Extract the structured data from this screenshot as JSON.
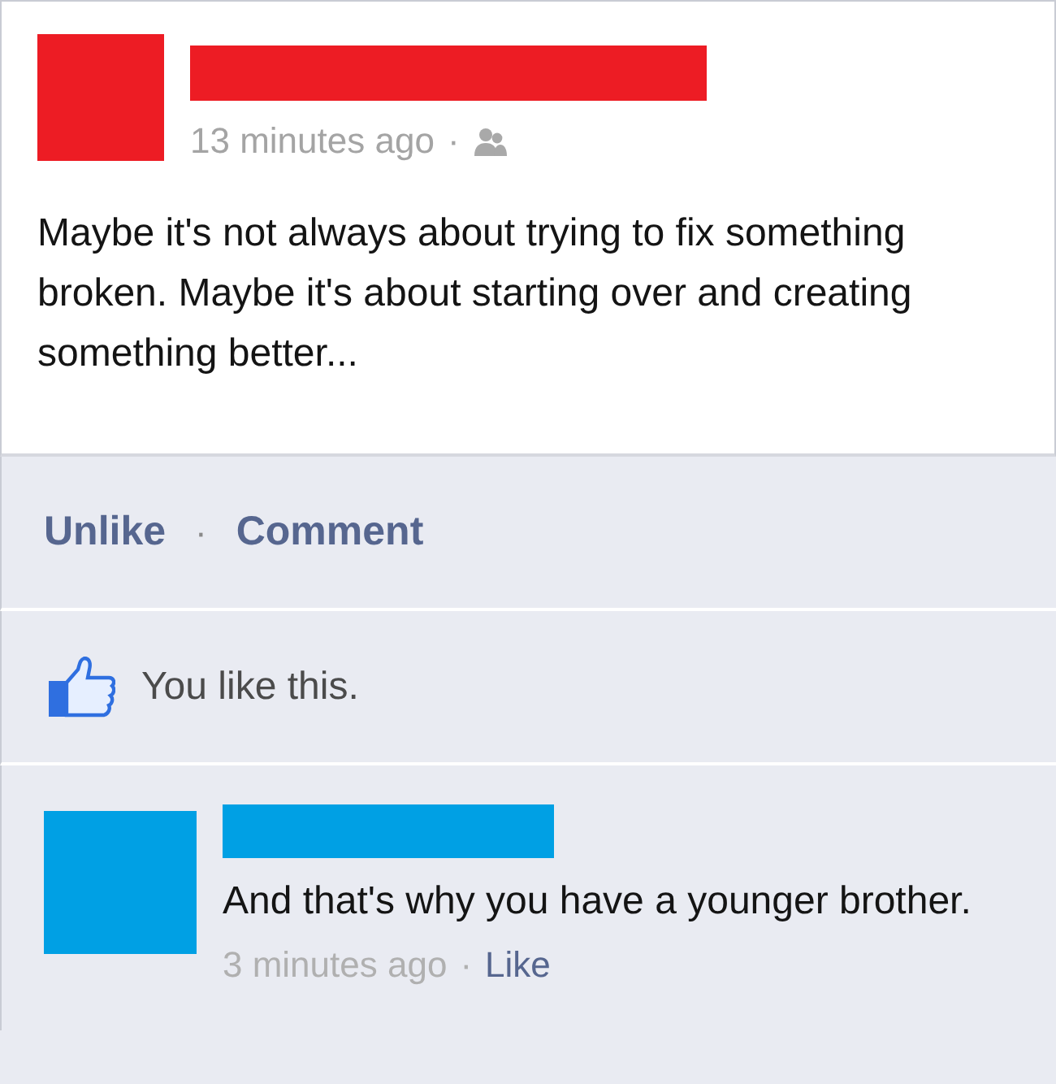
{
  "post": {
    "author": {
      "color": "#ed1c24"
    },
    "time": "13 minutes ago",
    "separator": "·",
    "text": "Maybe it's not always about trying to fix something broken. Maybe it's about starting over and creating something better..."
  },
  "actions": {
    "items": [
      {
        "label": "Unlike"
      },
      {
        "label": "Comment"
      }
    ],
    "separator": "·"
  },
  "likes": {
    "text": "You like this.",
    "liked": true
  },
  "comments": [
    {
      "author": {
        "color": "#00a0e4"
      },
      "text": "And that's why you have a younger brother.",
      "time": "3 minutes ago",
      "separator": "·",
      "action": "Like"
    }
  ]
}
